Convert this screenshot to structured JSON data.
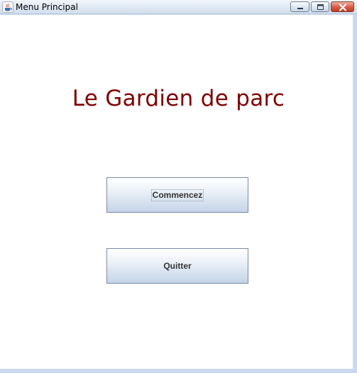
{
  "window": {
    "title": "Menu Principal",
    "icon": "java-cup-icon",
    "controls": [
      "minimize-icon",
      "maximize-icon",
      "close-icon"
    ]
  },
  "main": {
    "title": "Le Gardien de parc",
    "title_color": "#800000",
    "buttons": {
      "start_label": "Commencez",
      "quit_label": "Quitter"
    }
  }
}
